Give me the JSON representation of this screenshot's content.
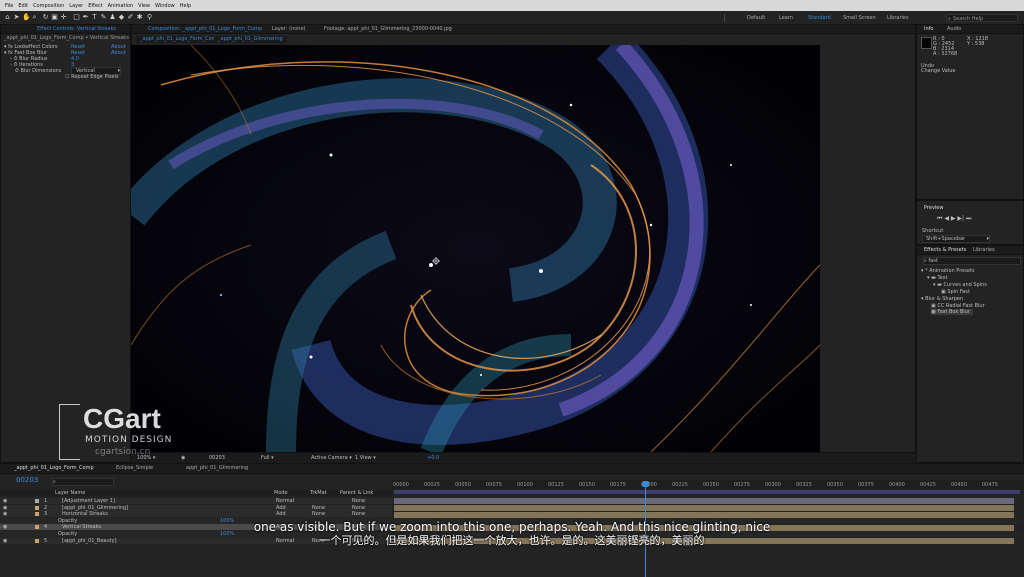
{
  "menu": [
    "File",
    "Edit",
    "Composition",
    "Layer",
    "Effect",
    "Animation",
    "View",
    "Window",
    "Help"
  ],
  "workspaces": [
    "Default",
    "Learn",
    "Standard",
    "Small Screen",
    "Libraries"
  ],
  "active_workspace": "Standard",
  "search_help": "Search Help",
  "effect_controls": {
    "tab": "Effect Controls: Vertical Streaks",
    "header": "_appt_phi_01_Logo_Form_Comp • Vertical Streaks",
    "effects": [
      {
        "name": "Lookeffect Colors",
        "reset": "Reset",
        "about": "About"
      },
      {
        "name": "Fast Box Blur",
        "reset": "Reset",
        "about": "About"
      }
    ],
    "props": [
      {
        "name": "Blur Radius",
        "value": "4.0"
      },
      {
        "name": "Iterations",
        "value": "3"
      },
      {
        "name": "Blur Dimensions",
        "value": "Vertical"
      }
    ],
    "repeat_edge": "Repeat Edge Pixels"
  },
  "viewer": {
    "comp_tab": "Composition: _appt_phi_01_Logo_Form_Comp",
    "layer_tab": "Layer: (none)",
    "footage_tab": "Footage: appt_phi_01_Glimmering_23000-0040.jpg",
    "breadcrumb_1": "_appt_phi_01_Logo_Form_Comp",
    "breadcrumb_2": "_appt_phi_01_Glimmering",
    "zoom": "100%",
    "timecode": "00203",
    "resolution": "Full",
    "camera": "Active Camera",
    "views": "1 View",
    "exposure": "+0.0"
  },
  "info": {
    "tabs": [
      "Info",
      "Audio"
    ],
    "r": "R : 0",
    "g": "G : 2452",
    "b": "B : 2314",
    "a": "A : 32768",
    "x": "X : 1218",
    "y": "Y : 538",
    "undo": "Undo",
    "change_value": "Change Value"
  },
  "preview": {
    "title": "Preview",
    "shortcut_label": "Shortcut",
    "shortcut_value": "Shift+Spacebar"
  },
  "effects_presets": {
    "tabs": [
      "Effects & Presets",
      "Libraries"
    ],
    "search": "fast",
    "tree": [
      {
        "label": "* Animation Presets",
        "indent": 0
      },
      {
        "label": "Text",
        "indent": 1
      },
      {
        "label": "Curves and Spins",
        "indent": 2
      },
      {
        "label": "Spin Fast",
        "indent": 3
      },
      {
        "label": "Blur & Sharpen",
        "indent": 0
      },
      {
        "label": "CC Radial Fast Blur",
        "indent": 2
      },
      {
        "label": "Fast Box Blur",
        "indent": 2
      }
    ]
  },
  "timeline": {
    "tabs": [
      "_appt_phi_01_Logo_Form_Comp",
      "Eclipse_Simple",
      "appt_phi_01_Glimmering"
    ],
    "timecode": "00203",
    "search_placeholder": "",
    "columns": {
      "source": "Layer Name",
      "mode": "Mode",
      "trkmat": "TrkMat",
      "parent": "Parent & Link"
    },
    "layers": [
      {
        "num": "1",
        "name": "[Adjustment Layer 1]",
        "mode": "Normal",
        "trk": "",
        "parent": "None",
        "color": "#a9a9a9"
      },
      {
        "num": "2",
        "name": "[appt_phi_01_Glimmering]",
        "mode": "Add",
        "trk": "None",
        "parent": "None",
        "color": "#c8a46a"
      },
      {
        "num": "3",
        "name": "Horizontal Streaks",
        "mode": "Add",
        "trk": "None",
        "parent": "None",
        "color": "#c8a46a"
      },
      {
        "num": "",
        "name": "Opacity",
        "mode": "100%",
        "trk": "",
        "parent": "",
        "color": ""
      },
      {
        "num": "4",
        "name": "Vertical Streaks",
        "mode": "Add",
        "trk": "None",
        "parent": "None",
        "color": "#c8a46a"
      },
      {
        "num": "",
        "name": "Opacity",
        "mode": "100%",
        "trk": "",
        "parent": "",
        "color": ""
      },
      {
        "num": "5",
        "name": "[appt_phi_01_Beauty]",
        "mode": "Normal",
        "trk": "None",
        "parent": "None",
        "color": "#c8a46a"
      }
    ],
    "ruler": [
      "00000",
      "00025",
      "00050",
      "00075",
      "00100",
      "00125",
      "00150",
      "00175",
      "00200",
      "00225",
      "00250",
      "00275",
      "00300",
      "00325",
      "00350",
      "00375",
      "00400",
      "00425",
      "00450",
      "00475"
    ]
  },
  "subtitles": {
    "en": "one as visible. But if we zoom into this one, perhaps. Yeah. And this nice glinting, nice",
    "cn": "一个可见的。但是如果我们把这一个放大，也许。是的。这美丽铿亮的，美丽的"
  },
  "watermark": {
    "brand": "CGart",
    "tagline": "MOTION DESIGN",
    "url": "cgartsion.cn"
  }
}
